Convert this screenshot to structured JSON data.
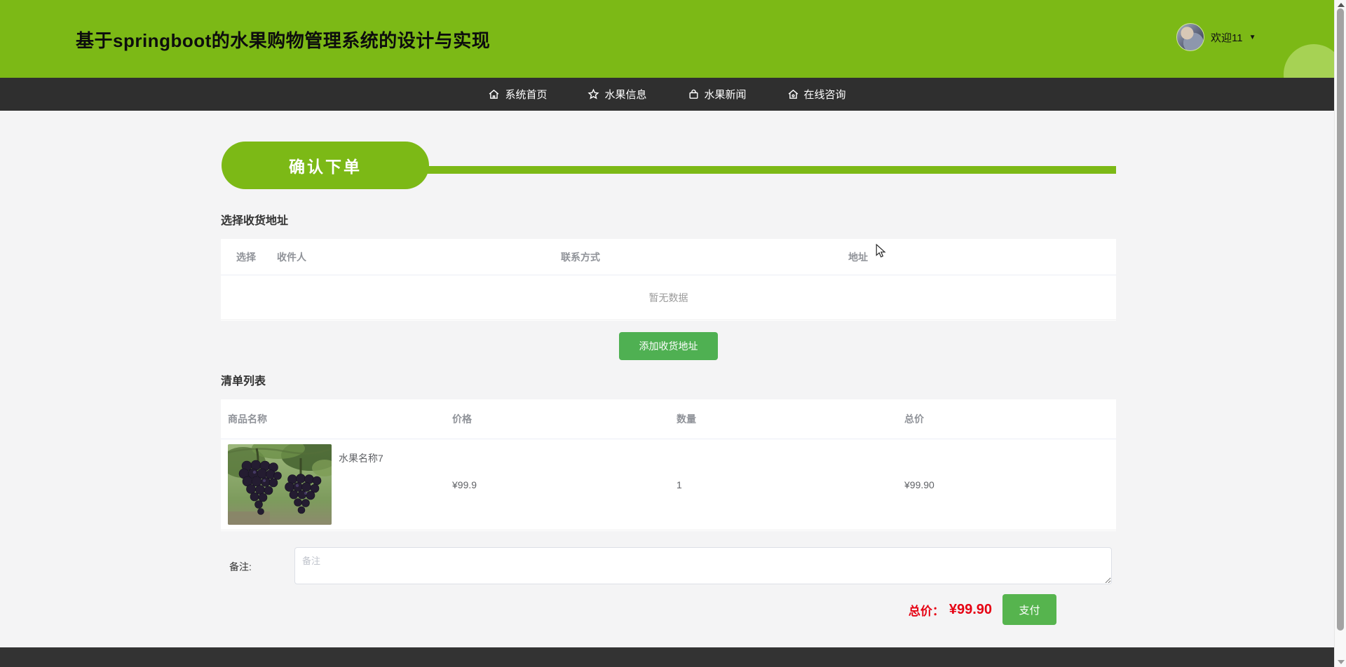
{
  "header": {
    "title": "基于springboot的水果购物管理系统的设计与实现",
    "welcome_text": "欢迎11",
    "caret": "▼"
  },
  "nav": {
    "items": [
      {
        "label": "系统首页",
        "icon": "home-icon"
      },
      {
        "label": "水果信息",
        "icon": "star-icon"
      },
      {
        "label": "水果新闻",
        "icon": "bag-icon"
      },
      {
        "label": "在线咨询",
        "icon": "home-chat-icon"
      }
    ]
  },
  "order": {
    "banner": "确认下单",
    "address": {
      "heading": "选择收货地址",
      "headers": [
        "选择",
        "收件人",
        "联系方式",
        "地址"
      ],
      "empty_text": "暂无数据",
      "add_button_label": "添加收货地址"
    },
    "cart": {
      "heading": "清单列表",
      "headers": [
        "商品名称",
        "价格",
        "数量",
        "总价"
      ],
      "items": [
        {
          "name": "水果名称7",
          "price": "¥99.9",
          "quantity": "1",
          "total": "¥99.90",
          "image": "grapes-photo"
        }
      ]
    },
    "remark": {
      "label": "备注:",
      "placeholder": "备注"
    },
    "checkout": {
      "total_label": "总价：",
      "total_value": "¥99.90",
      "pay_button_label": "支付"
    }
  },
  "colors": {
    "header_green": "#7cb916",
    "nav_dark": "#2f2f2f",
    "button_green": "#4fb052",
    "pay_green": "#56b44e",
    "total_red": "#e60012"
  }
}
